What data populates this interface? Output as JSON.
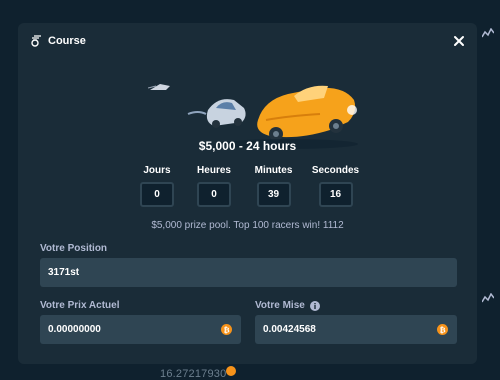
{
  "modal": {
    "title": "Course",
    "prize_heading": "$5,000 - 24 hours",
    "countdown": [
      {
        "label": "Jours",
        "value": "0"
      },
      {
        "label": "Heures",
        "value": "0"
      },
      {
        "label": "Minutes",
        "value": "39"
      },
      {
        "label": "Secondes",
        "value": "16"
      }
    ],
    "prize_info": "$5,000 prize pool. Top 100 racers win! 1112",
    "position": {
      "label": "Votre Position",
      "value": "3171st"
    },
    "prix": {
      "label": "Votre Prix Actuel",
      "value": "0.00000000"
    },
    "mise": {
      "label": "Votre Mise",
      "value": "0.00424568"
    }
  },
  "background": {
    "amount": "16.27217930"
  },
  "colors": {
    "coin": "#f7931a",
    "car": "#f6a21b",
    "accent_bg": "#1a2c38"
  },
  "icons": {
    "title": "race-icon",
    "close": "close-icon",
    "info": "info-icon",
    "currency": "bitcoin-icon"
  }
}
